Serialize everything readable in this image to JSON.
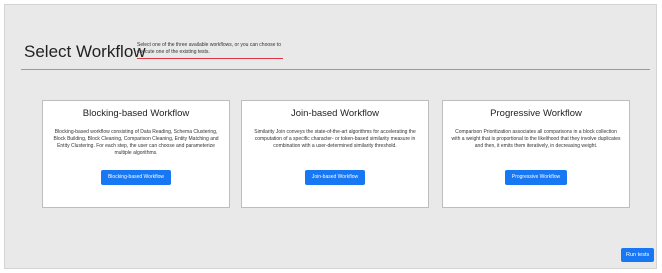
{
  "header": {
    "title": "Select Workflow",
    "subtitle": "Select one of the three available workflows, or you can choose to execute one of the existing tests."
  },
  "cards": [
    {
      "title": "Blocking-based Workflow",
      "description": "Blocking-based workflow consisting of Data Reading, Schema Clustering, Block Building, Block Cleaning, Comparison Cleaning, Entity Matching and Entity Clustering. For each step, the user can choose and parameterize multiple algorithms.",
      "button_label": "Blocking-based Workflow"
    },
    {
      "title": "Join-based Workflow",
      "description": "Similarity Join conveys the state-of-the-art algorithms for accelerating the computation of a specific character- or token-based similarity measure in combination with a user-determined similarity threshold.",
      "button_label": "Join-based Workflow"
    },
    {
      "title": "Progressive Workflow",
      "description": "Comparison Prioritization associates all comparisons in a block collection with a weight that is proportional to the likelihood that they involve duplicates and then, it emits them iteratively, in decreasing weight.",
      "button_label": "Progressive Workflow"
    }
  ],
  "footer": {
    "run_tests_label": "Run tests"
  },
  "colors": {
    "primary": "#1877f2",
    "underline": "#dc3545",
    "background": "#e9e9e9"
  }
}
